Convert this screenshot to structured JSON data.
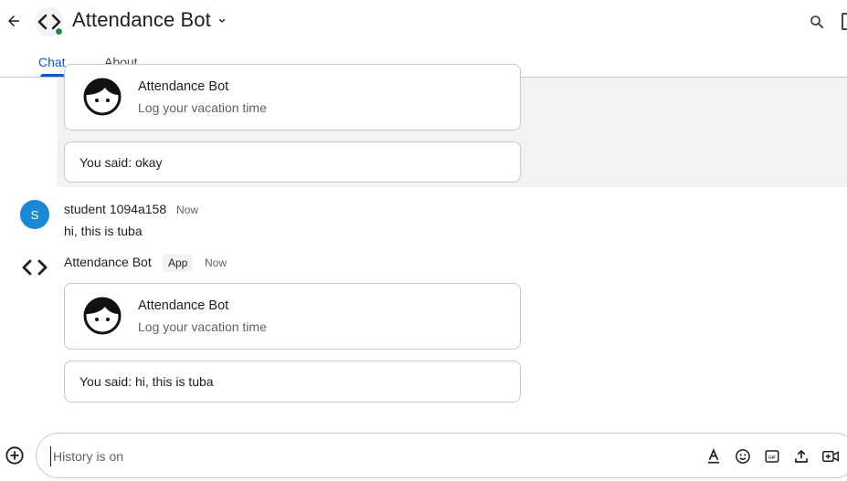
{
  "header": {
    "title": "Attendance Bot",
    "back_icon": "arrow-back-icon",
    "search_icon": "search-icon",
    "presence_color": "#1e8e3e"
  },
  "tabs": [
    {
      "label": "Chat",
      "active": true
    },
    {
      "label": "About",
      "active": false
    }
  ],
  "thread": {
    "card": {
      "title": "Attendance Bot",
      "subtitle": "Log your vacation time"
    },
    "reply": "You said: okay"
  },
  "messages": [
    {
      "sender": "student 1094a158",
      "avatar_initial": "S",
      "time": "Now",
      "text": "hi, this is tuba"
    },
    {
      "sender": "Attendance Bot",
      "badge": "App",
      "time": "Now",
      "card": {
        "title": "Attendance Bot",
        "subtitle": "Log your vacation time"
      },
      "reply": "You said: hi, this is tuba"
    }
  ],
  "composer": {
    "placeholder": "History is on",
    "tools": [
      "format-text-icon",
      "emoji-icon",
      "gif-icon",
      "upload-icon",
      "video-call-icon"
    ]
  },
  "colors": {
    "accent": "#0b57d0",
    "user_avatar": "#1a88d2"
  }
}
